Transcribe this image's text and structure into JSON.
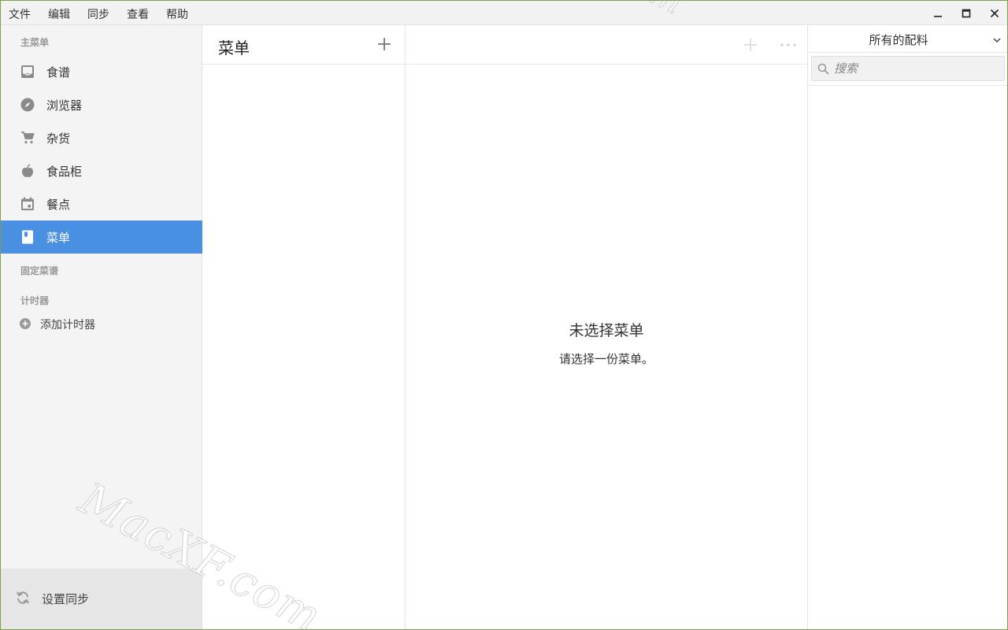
{
  "menubar": {
    "items": [
      "文件",
      "编辑",
      "同步",
      "查看",
      "帮助"
    ]
  },
  "sidebar": {
    "main_section": "主菜单",
    "items": [
      {
        "label": "食谱",
        "icon": "inbox-icon"
      },
      {
        "label": "浏览器",
        "icon": "compass-icon"
      },
      {
        "label": "杂货",
        "icon": "cart-icon"
      },
      {
        "label": "食品柜",
        "icon": "apple-icon"
      },
      {
        "label": "餐点",
        "icon": "calendar-icon"
      },
      {
        "label": "菜单",
        "icon": "book-icon",
        "active": true
      }
    ],
    "pinned_section": "固定菜谱",
    "timers_section": "计时器",
    "add_timer": "添加计时器",
    "sync_setup": "设置同步"
  },
  "list": {
    "title": "菜单"
  },
  "detail": {
    "empty_title": "未选择菜单",
    "empty_subtitle": "请选择一份菜单。"
  },
  "ingredients": {
    "filter": "所有的配料",
    "search_placeholder": "搜索"
  },
  "watermark": "MacXF.com",
  "colors": {
    "accent": "#4a90e2",
    "sidebar_bg": "#f4f4f4",
    "footer_bg": "#e6e6e6",
    "window_border": "#7aa04a"
  }
}
